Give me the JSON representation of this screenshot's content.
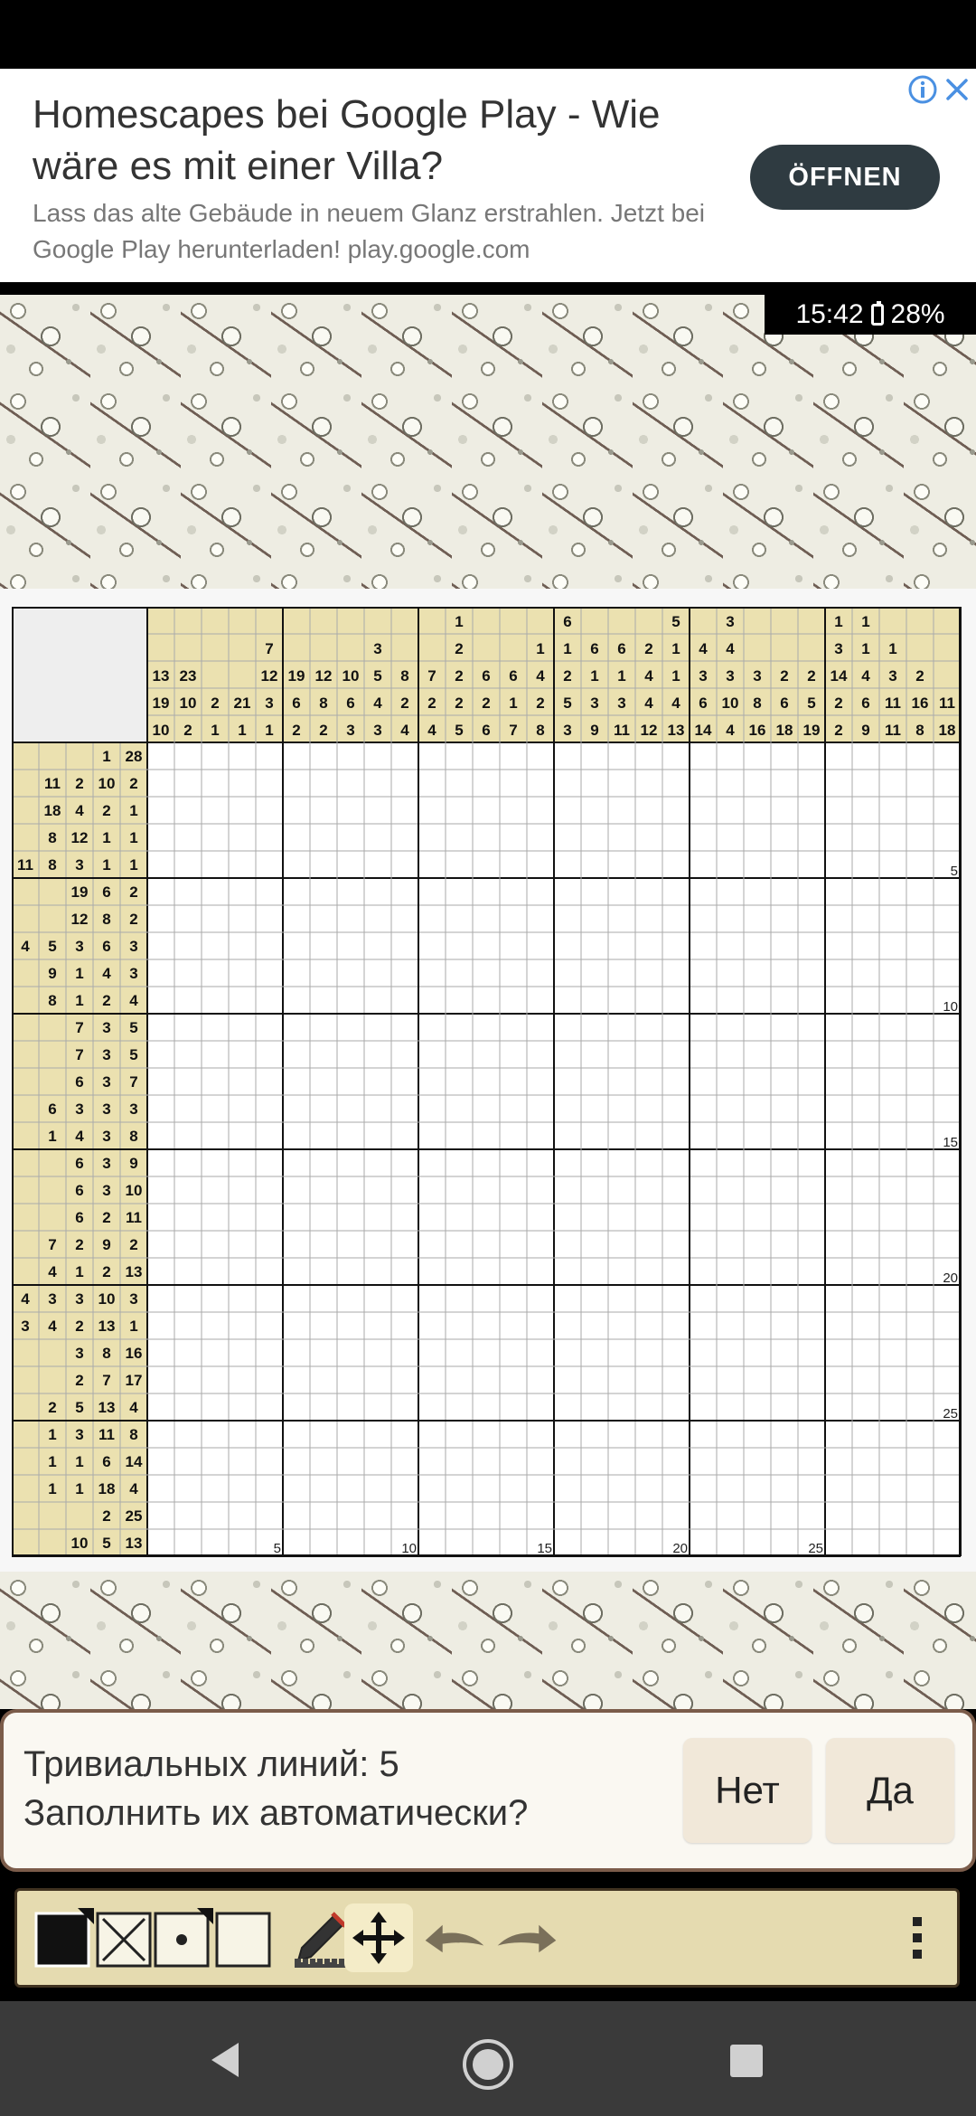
{
  "status": {
    "time": "15:42",
    "battery": "28%"
  },
  "ad": {
    "title": "Homescapes bei Google Play - Wie wäre es mit einer Villa?",
    "subtitle": "Lass das alte Gebäude in neuem Glanz erstrahlen. Jetzt bei Google Play herunterladen! play.google.com",
    "button_label": "ÖFFNEN"
  },
  "puzzle": {
    "size": 30,
    "column_clues": [
      [
        10,
        19,
        13
      ],
      [
        2,
        10,
        23
      ],
      [
        1,
        2
      ],
      [
        1,
        21
      ],
      [
        1,
        3,
        12,
        7
      ],
      [
        2,
        6,
        19
      ],
      [
        2,
        8,
        12
      ],
      [
        3,
        6,
        10
      ],
      [
        3,
        4,
        5,
        3
      ],
      [
        4,
        2,
        8
      ],
      [
        4,
        2,
        7
      ],
      [
        5,
        2,
        2,
        2,
        1
      ],
      [
        6,
        2,
        6
      ],
      [
        7,
        1,
        6
      ],
      [
        8,
        2,
        4,
        1
      ],
      [
        3,
        5,
        2,
        1,
        6
      ],
      [
        9,
        3,
        1,
        6
      ],
      [
        11,
        3,
        1,
        6
      ],
      [
        12,
        4,
        4,
        2
      ],
      [
        13,
        4,
        1,
        1,
        5
      ],
      [
        14,
        6,
        3,
        4
      ],
      [
        4,
        10,
        3,
        4,
        3
      ],
      [
        16,
        8,
        3
      ],
      [
        18,
        6,
        2
      ],
      [
        19,
        5,
        2
      ],
      [
        2,
        2,
        14,
        3,
        1
      ],
      [
        9,
        6,
        4,
        1,
        1
      ],
      [
        11,
        11,
        3,
        1
      ],
      [
        8,
        16,
        2
      ],
      [
        18,
        11
      ]
    ],
    "row_clues": [
      [
        1,
        28
      ],
      [
        11,
        2,
        10,
        2
      ],
      [
        18,
        4,
        2,
        1
      ],
      [
        8,
        12,
        1,
        1
      ],
      [
        11,
        8,
        3,
        1,
        1
      ],
      [
        19,
        6,
        2
      ],
      [
        12,
        8,
        2
      ],
      [
        4,
        5,
        3,
        6,
        3
      ],
      [
        9,
        1,
        4,
        3
      ],
      [
        8,
        1,
        2,
        4
      ],
      [
        7,
        3,
        5
      ],
      [
        7,
        3,
        5
      ],
      [
        6,
        3,
        7
      ],
      [
        6,
        3,
        3,
        3
      ],
      [
        1,
        4,
        3,
        8
      ],
      [
        6,
        3,
        9
      ],
      [
        6,
        3,
        10
      ],
      [
        6,
        2,
        11
      ],
      [
        7,
        2,
        9,
        2
      ],
      [
        4,
        1,
        2,
        13
      ],
      [
        4,
        3,
        3,
        10,
        3
      ],
      [
        3,
        4,
        2,
        13,
        1
      ],
      [
        3,
        8,
        16
      ],
      [
        2,
        7,
        17
      ],
      [
        2,
        5,
        13,
        4
      ],
      [
        1,
        3,
        11,
        8
      ],
      [
        1,
        1,
        6,
        14
      ],
      [
        1,
        1,
        18,
        4
      ],
      [
        2,
        25
      ],
      [
        10,
        5,
        13
      ]
    ],
    "row_markers": [
      "5",
      "10",
      "15",
      "20",
      "25"
    ],
    "col_markers": [
      "5",
      "10",
      "15",
      "20",
      "25"
    ]
  },
  "dialog": {
    "line1": "Тривиальных линий: 5",
    "line2": "Заполнить их автоматически?",
    "no_label": "Нет",
    "yes_label": "Да"
  },
  "toolbar": {
    "tools": [
      "fill-square-icon",
      "cross-mark-icon",
      "dot-mark-icon",
      "empty-square-icon",
      "pencil-ruler-icon",
      "move-arrows-icon",
      "undo-icon",
      "redo-icon",
      "more-menu-icon"
    ],
    "active_tool": "move-arrows-icon"
  },
  "colors": {
    "clue_bg": "#ebe1b0",
    "grid_line": "#aaaaaa",
    "block_line": "#111111",
    "dialog_border": "#7b5c4a",
    "ad_button": "#2f3b41",
    "info_icon": "#4a90e2"
  }
}
